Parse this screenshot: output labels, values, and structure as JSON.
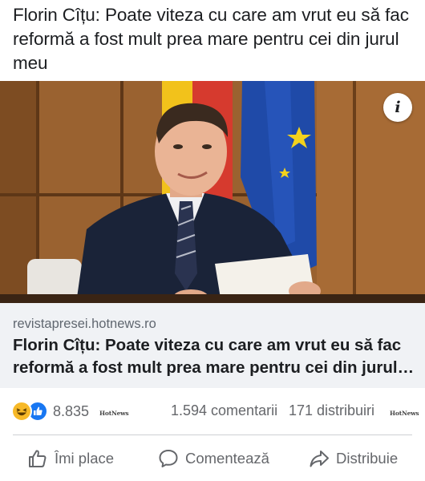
{
  "post": {
    "title": "Florin Cîțu: Poate viteza cu care am vrut eu să fac reformă a fost mult prea mare pentru cei din jurul meu"
  },
  "image": {
    "info_button_label": "i"
  },
  "link_card": {
    "domain": "revistapresei.hotnews.ro",
    "title": "Florin Cîțu: Poate viteza cu care am vrut eu să fac reformă a fost mult prea mare pentru cei din jurul meu"
  },
  "stats": {
    "reaction_icons": [
      "haha-icon",
      "like-icon"
    ],
    "reactions_count": "8.835",
    "page_logo": "HotNews",
    "comments": "1.594 comentarii",
    "shares": "171 distribuiri"
  },
  "actions": {
    "like_label": "Îmi place",
    "comment_label": "Comentează",
    "share_label": "Distribuie"
  },
  "colors": {
    "accent": "#1877f2",
    "haha": "#f7b928",
    "secondary_text": "#65676b",
    "card_bg": "#f0f2f5"
  }
}
